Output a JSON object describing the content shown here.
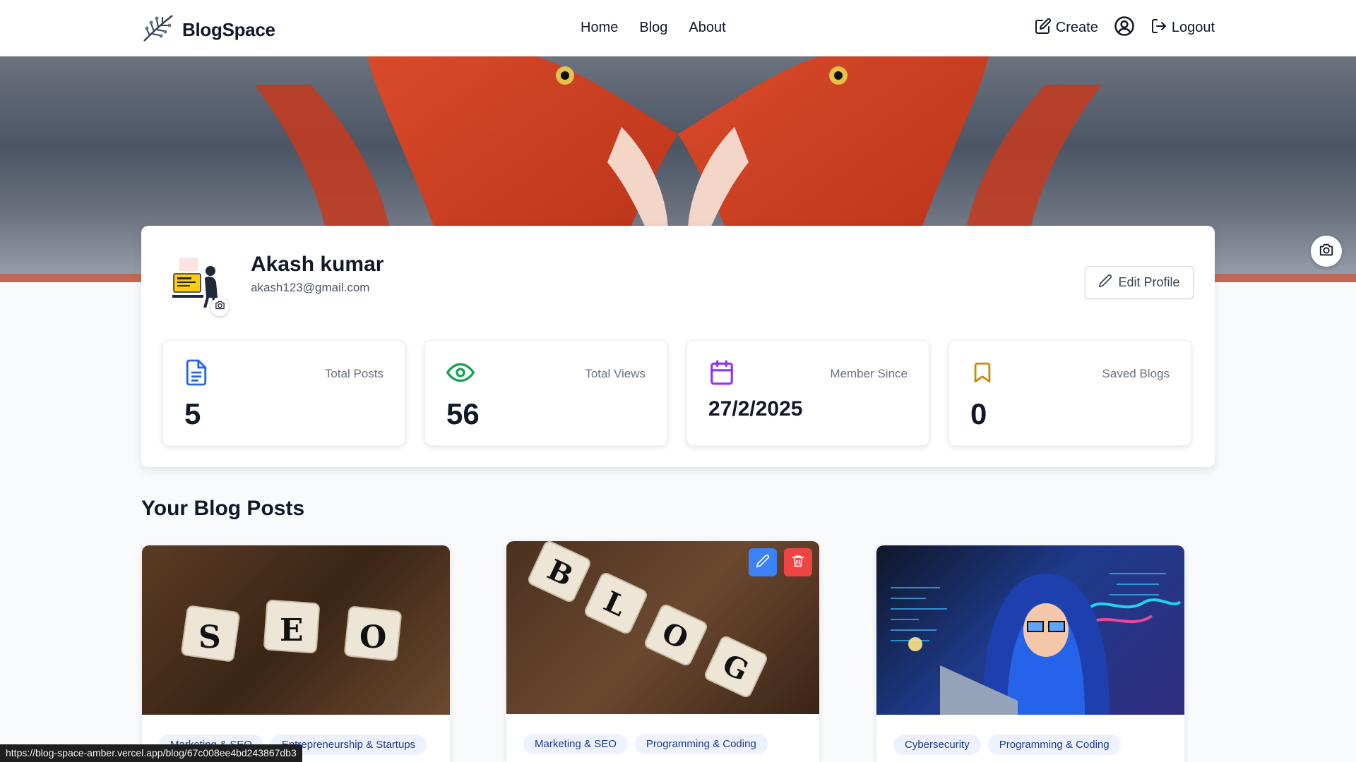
{
  "navbar": {
    "brand": "BlogSpace",
    "links": [
      "Home",
      "Blog",
      "About"
    ],
    "create_label": "Create",
    "logout_label": "Logout"
  },
  "profile": {
    "name": "Akash kumar",
    "email": "akash123@gmail.com",
    "edit_label": "Edit Profile"
  },
  "stats": [
    {
      "label": "Total Posts",
      "value": "5",
      "icon": "document-icon",
      "color": "#2563eb"
    },
    {
      "label": "Total Views",
      "value": "56",
      "icon": "eye-icon",
      "color": "#16a34a"
    },
    {
      "label": "Member Since",
      "value": "27/2/2025",
      "icon": "calendar-icon",
      "color": "#9333ea"
    },
    {
      "label": "Saved Blogs",
      "value": "0",
      "icon": "bookmark-icon",
      "color": "#ca8a04"
    }
  ],
  "posts_section": {
    "title": "Your Blog Posts",
    "posts": [
      {
        "tags": [
          "Marketing & SEO",
          "Entrepreneurship & Startups"
        ]
      },
      {
        "tags": [
          "Marketing & SEO",
          "Programming & Coding"
        ]
      },
      {
        "tags": [
          "Cybersecurity",
          "Programming & Coding"
        ]
      }
    ]
  },
  "status_bar": {
    "url": "https://blog-space-amber.vercel.app/blog/67c008ee4bd243867db3"
  },
  "colors": {
    "accent_blue": "#3b82f6",
    "danger_red": "#ef4444",
    "tag_bg": "#eef2ff",
    "tag_text": "#1e3a8a"
  }
}
